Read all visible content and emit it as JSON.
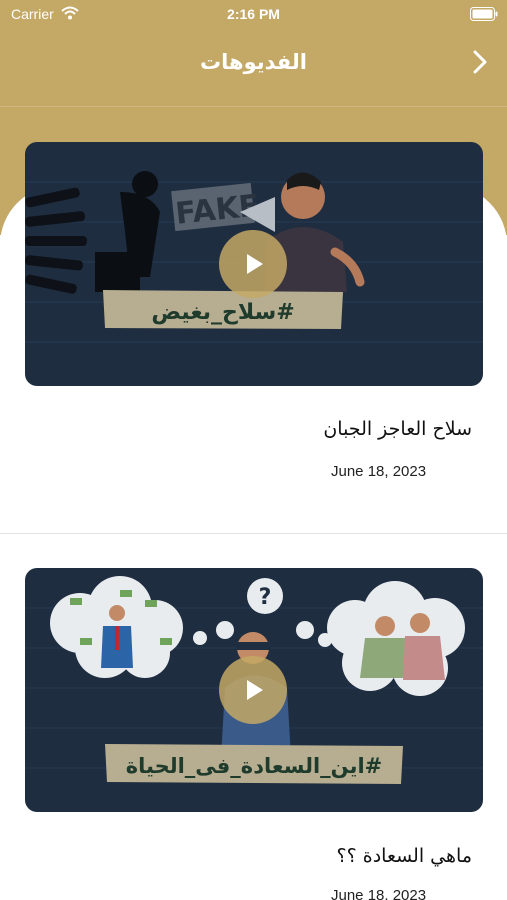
{
  "status_bar": {
    "carrier": "Carrier",
    "time": "2:16 PM"
  },
  "nav": {
    "title": "الفديوهات",
    "back_icon": "chevron-right-icon"
  },
  "colors": {
    "header": "#c4a865",
    "thumbnail": "#1e2d40",
    "play_button": "#c4a865"
  },
  "videos": [
    {
      "thumbnail_text": "#سلاح_بغيض",
      "thumbnail_badge": "FAKE",
      "title": "سلاح العاجز الجبان",
      "date": "June 18, 2023"
    },
    {
      "thumbnail_text": "#اين_السعادة_فى_الحياة",
      "title": "ماهي السعادة ؟؟",
      "date": "June 18, 2023"
    }
  ]
}
